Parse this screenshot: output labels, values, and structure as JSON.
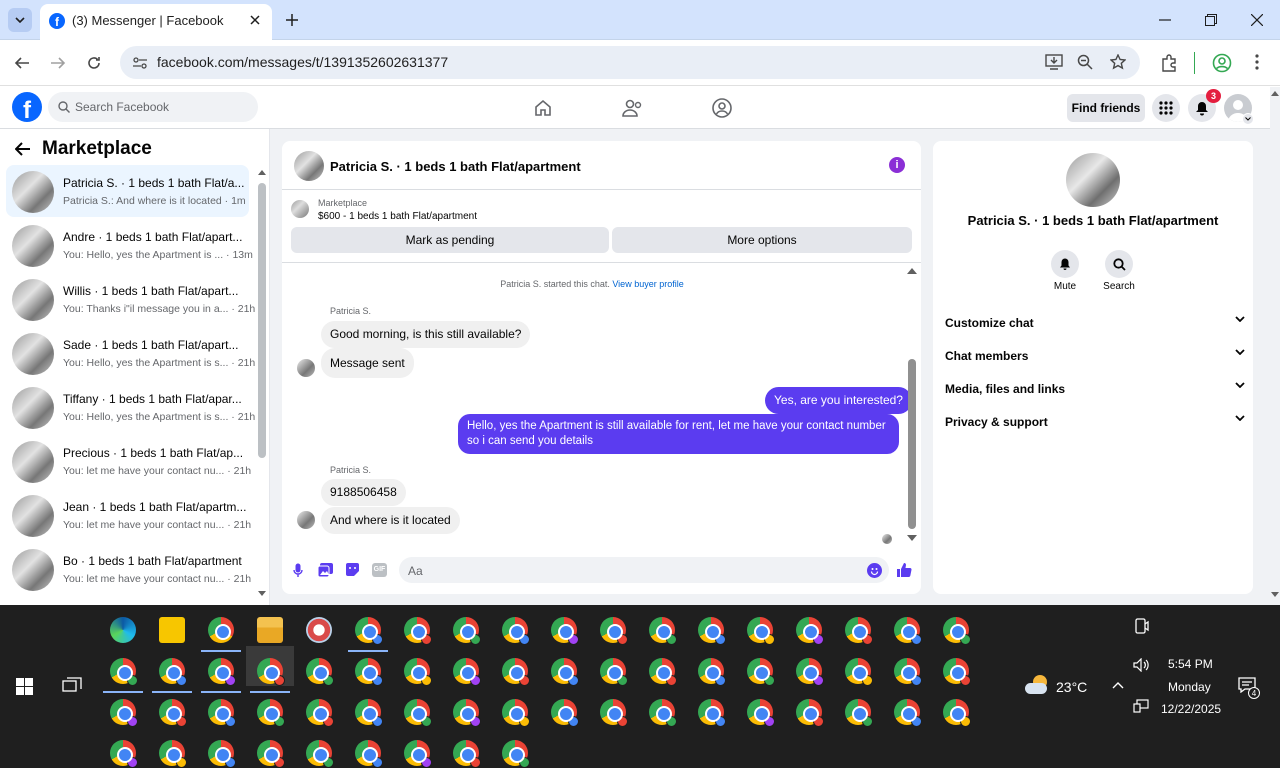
{
  "browser": {
    "tab_title": "(3) Messenger | Facebook",
    "url": "facebook.com/messages/t/1391352602631377"
  },
  "fb_header": {
    "search_placeholder": "Search Facebook",
    "find_friends": "Find friends",
    "notification_count": "3"
  },
  "sidebar": {
    "title": "Marketplace",
    "conversations": [
      {
        "title": "Patricia S. · 1 beds 1 bath Flat/a...",
        "preview": "Patricia S.: And where is it located · 1m",
        "selected": true
      },
      {
        "title": "Andre · 1 beds 1 bath Flat/apart...",
        "preview": "You: Hello, yes the Apartment is ... · 13m"
      },
      {
        "title": "Willis · 1 beds 1 bath Flat/apart...",
        "preview": "You: Thanks i\"il message you in a... · 21h"
      },
      {
        "title": "Sade · 1 beds 1 bath Flat/apart...",
        "preview": "You: Hello, yes the Apartment is s... · 21h"
      },
      {
        "title": "Tiffany · 1 beds 1 bath Flat/apar...",
        "preview": "You: Hello, yes the Apartment is s... · 21h"
      },
      {
        "title": "Precious · 1 beds 1 bath Flat/ap...",
        "preview": "You: let me have your contact nu... · 21h"
      },
      {
        "title": "Jean · 1 beds 1 bath Flat/apartm...",
        "preview": "You: let me have your contact nu... · 21h"
      },
      {
        "title": "Bo · 1 beds 1 bath Flat/apartment",
        "preview": "You: let me have your contact nu... · 21h"
      }
    ]
  },
  "chat": {
    "title": "Patricia S. · 1 beds 1 bath Flat/apartment",
    "listing_label": "Marketplace",
    "listing_desc": "$600 - 1 beds 1 bath Flat/apartment",
    "mark_pending": "Mark as pending",
    "more_options": "More options",
    "started_text": "Patricia S. started this chat.",
    "view_profile": "View buyer profile",
    "sender_name": "Patricia S.",
    "messages": {
      "m1": "Good morning, is this still available?",
      "m2": "Message sent",
      "m3": "Yes, are you interested?",
      "m4a": "Hello, yes the Apartment is still available for rent, let me have your contact number",
      "m4b": "so i can send you details",
      "m5": "9188506458",
      "m6": "And where is it located"
    },
    "composer_placeholder": "Aa"
  },
  "info_panel": {
    "title": "Patricia S. · 1 beds 1 bath Flat/apartment",
    "mute": "Mute",
    "search": "Search",
    "sections": [
      "Customize chat",
      "Chat members",
      "Media, files and links",
      "Privacy & support"
    ]
  },
  "taskbar": {
    "temperature": "23°C",
    "time": "5:54 PM",
    "day": "Monday",
    "date": "12/22/2025",
    "notification_count": "4"
  },
  "colors": {
    "accent": "#5b3cf0",
    "fb_blue": "#0866ff",
    "badge_red": "#e41e3f"
  }
}
